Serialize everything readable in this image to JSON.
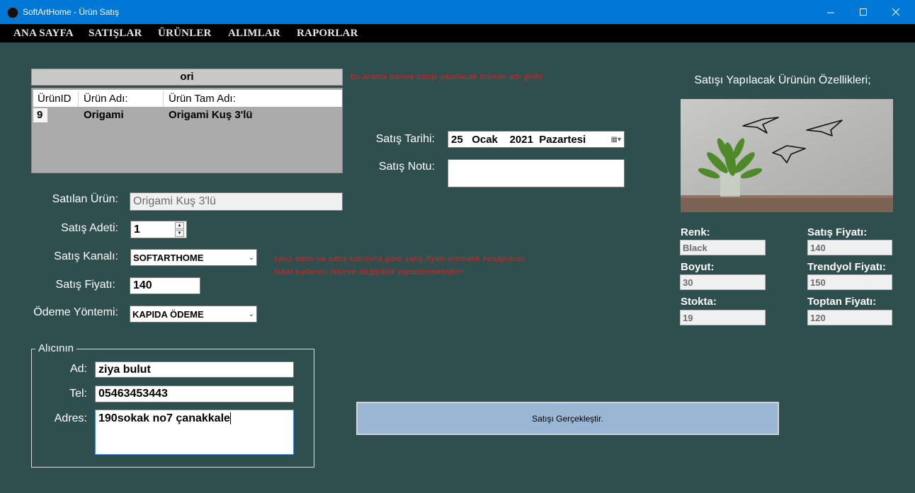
{
  "window": {
    "title": "SoftArtHome - Ürün Satış"
  },
  "menu": [
    "ANA SAYFA",
    "SATIŞLAR",
    "ÜRÜNLER",
    "ALIMLAR",
    "RAPORLAR"
  ],
  "search": {
    "value": "ori",
    "hint": "bu arama barına satışı yapılacak ürünün adı girilir"
  },
  "grid": {
    "columns": [
      "ÜrünID",
      "Ürün Adı:",
      "Ürün Tam Adı:"
    ],
    "rows": [
      [
        "9",
        "Origami",
        "Origami Kuş 3'lü"
      ]
    ]
  },
  "form": {
    "sold_product_label": "Satılan Ürün:",
    "sold_product_value": "Origami Kuş 3'lü",
    "qty_label": "Satış Adeti:",
    "qty_value": "1",
    "channel_label": "Satış Kanalı:",
    "channel_value": "SOFTARTHOME",
    "price_label": "Satış Fiyatı:",
    "price_value": "140",
    "payment_label": "Ödeme Yöntemi:",
    "payment_value": "KAPIDA ÖDEME",
    "price_note_line1": "satış adeti ve satış kanalına göre satış fiyatı otomatik hesaplanır,",
    "price_note_line2": "fakat kullanıcı isterse değişiklik yapabilmektedir!!",
    "date_label": "Satış Tarihi:",
    "date_day": "25",
    "date_month": "Ocak",
    "date_year": "2021",
    "date_weekday": "Pazartesi",
    "note_label": "Satış Notu:",
    "note_value": ""
  },
  "recipient": {
    "legend": "Alıcının",
    "name_label": "Ad:",
    "name_value": "ziya bulut",
    "phone_label": "Tel:",
    "phone_value": "05463453443",
    "address_label": "Adres:",
    "address_value": "190sokak no7 çanakkale"
  },
  "submit_label": "Satışı Gerçekleştir.",
  "product_props": {
    "heading": "Satışı Yapılacak Ürünün Özellikleri;",
    "color_label": "Renk:",
    "color_value": "Black",
    "size_label": "Boyut:",
    "size_value": "30",
    "stock_label": "Stokta:",
    "stock_value": "19",
    "sale_price_label": "Satış Fiyatı:",
    "sale_price_value": "140",
    "trendyol_label": "Trendyol Fiyatı:",
    "trendyol_value": "150",
    "wholesale_label": "Toptan Fiyatı:",
    "wholesale_value": "120"
  },
  "colors": {
    "background": "#2f4f4f",
    "titlebar": "#0078d7",
    "menubar": "#000000",
    "note_red": "#e0201e",
    "button": "#9ab6d4"
  }
}
